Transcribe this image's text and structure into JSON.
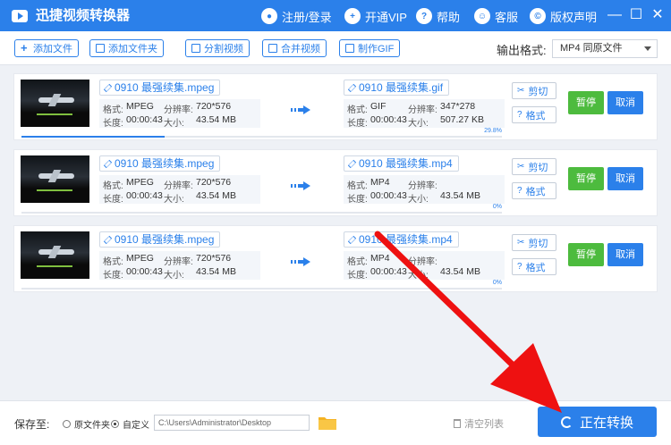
{
  "app": {
    "title": "迅捷视频转换器",
    "menu": [
      {
        "label": "注册/登录",
        "icon": "user-icon"
      },
      {
        "label": "开通VIP",
        "icon": "vip-icon"
      },
      {
        "label": "帮助",
        "icon": "help-icon"
      },
      {
        "label": "客服",
        "icon": "support-icon"
      },
      {
        "label": "版权声明",
        "icon": "copyright-icon"
      }
    ],
    "window_buttons": {
      "minimize": "—",
      "maximize": "☐",
      "close": "✕"
    }
  },
  "toolbar": {
    "buttons": [
      "添加文件",
      "添加文件夹",
      "分割视频",
      "合并视频",
      "制作GIF"
    ],
    "output_format_label": "输出格式:",
    "output_format_value": "MP4  同原文件"
  },
  "tasks": [
    {
      "source": {
        "name": "0910 最强续集.mpeg",
        "format": "MPEG",
        "resolution": "720*576",
        "duration": "00:00:43",
        "size": "43.54 MB"
      },
      "target": {
        "name": "0910 最强续集.gif",
        "format": "GIF",
        "resolution": "347*278",
        "duration": "00:00:43",
        "size": "507.27 KB"
      },
      "progress": 29.8,
      "progress_label": "29.8%"
    },
    {
      "source": {
        "name": "0910 最强续集.mpeg",
        "format": "MPEG",
        "resolution": "720*576",
        "duration": "00:00:43",
        "size": "43.54 MB"
      },
      "target": {
        "name": "0910 最强续集.mp4",
        "format": "MP4",
        "resolution": "",
        "duration": "00:00:43",
        "size": "43.54 MB"
      },
      "progress": 0,
      "progress_label": "0%"
    },
    {
      "source": {
        "name": "0910 最强续集.mpeg",
        "format": "MPEG",
        "resolution": "720*576",
        "duration": "00:00:43",
        "size": "43.54 MB"
      },
      "target": {
        "name": "0910 最强续集.mp4",
        "format": "MP4",
        "resolution": "",
        "duration": "00:00:43",
        "size": "43.54 MB"
      },
      "progress": 0,
      "progress_label": "0%"
    }
  ],
  "labels": {
    "format": "格式:",
    "resolution": "分辨率:",
    "duration": "长度:",
    "size": "大小:",
    "cut": "剪切",
    "fmt": "格式",
    "pause": "暂停",
    "cancel": "取消"
  },
  "bottom": {
    "save_to": "保存至:",
    "option_original": "原文件夹",
    "option_custom": "自定义",
    "path": "C:\\Users\\Administrator\\Desktop",
    "clear_list": "清空列表",
    "convert": "正在转换"
  },
  "colors": {
    "primary": "#2b80ea",
    "pause_green": "#4dbb3e",
    "annotation_red": "#ee1111"
  }
}
